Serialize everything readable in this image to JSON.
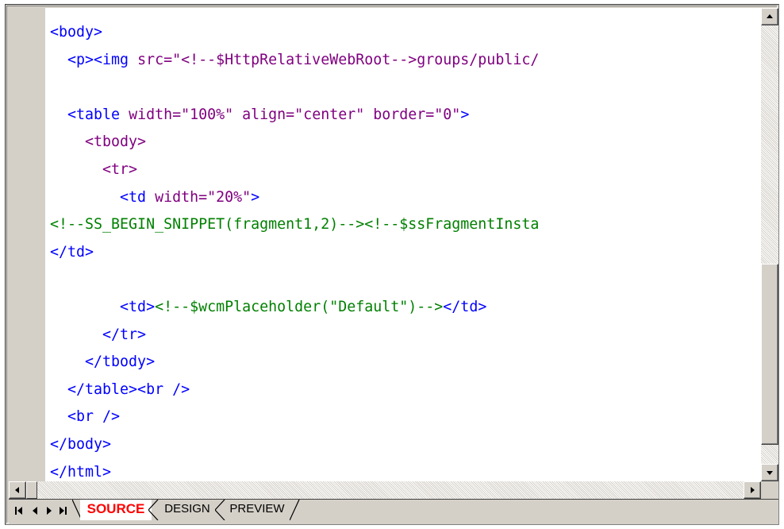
{
  "editor": {
    "lines": [
      [
        {
          "t": "<body>",
          "c": "tag"
        }
      ],
      [
        {
          "t": "  <p><img ",
          "c": "tag"
        },
        {
          "t": "src=\"<!--$HttpRelativeWebRoot-->groups/public/",
          "c": "attr"
        }
      ],
      [],
      [
        {
          "t": "  <table ",
          "c": "tag"
        },
        {
          "t": "width=\"100%\" align=\"center\" border=\"0\"",
          "c": "attr"
        },
        {
          "t": ">",
          "c": "tag"
        }
      ],
      [
        {
          "t": "    <tbody>",
          "c": "attr"
        }
      ],
      [
        {
          "t": "      <tr>",
          "c": "attr"
        }
      ],
      [
        {
          "t": "        <td ",
          "c": "tag"
        },
        {
          "t": "width=\"20%\"",
          "c": "attr"
        },
        {
          "t": ">",
          "c": "tag"
        }
      ],
      [
        {
          "t": "<!--SS_BEGIN_SNIPPET(fragment1,2)--><!--$ssFragmentInsta",
          "c": "cmt"
        }
      ],
      [
        {
          "t": "</td>",
          "c": "tag"
        }
      ],
      [],
      [
        {
          "t": "        <td>",
          "c": "tag"
        },
        {
          "t": "<!--$wcmPlaceholder(\"Default\")-->",
          "c": "cmt"
        },
        {
          "t": "</td>",
          "c": "tag"
        }
      ],
      [
        {
          "t": "      </tr>",
          "c": "tag"
        }
      ],
      [
        {
          "t": "    </tbody>",
          "c": "tag"
        }
      ],
      [
        {
          "t": "  </table><br />",
          "c": "tag"
        }
      ],
      [
        {
          "t": "  <br />",
          "c": "tag"
        }
      ],
      [
        {
          "t": "</body>",
          "c": "tag"
        }
      ],
      [
        {
          "t": "</html>",
          "c": "tag"
        }
      ]
    ]
  },
  "tabs": {
    "source": "SOURCE",
    "design": "DESIGN",
    "preview": "PREVIEW"
  },
  "colors": {
    "tag": "#0000ff",
    "attribute": "#800080",
    "comment": "#008000",
    "active_tab": "#ff0000"
  },
  "icons": {
    "nav_first": "first-page-icon",
    "nav_prev": "previous-page-icon",
    "nav_next": "next-page-icon",
    "nav_last": "last-page-icon",
    "scroll_up": "scroll-up-arrow-icon",
    "scroll_down": "scroll-down-arrow-icon",
    "scroll_left": "scroll-left-arrow-icon",
    "scroll_right": "scroll-right-arrow-icon"
  }
}
